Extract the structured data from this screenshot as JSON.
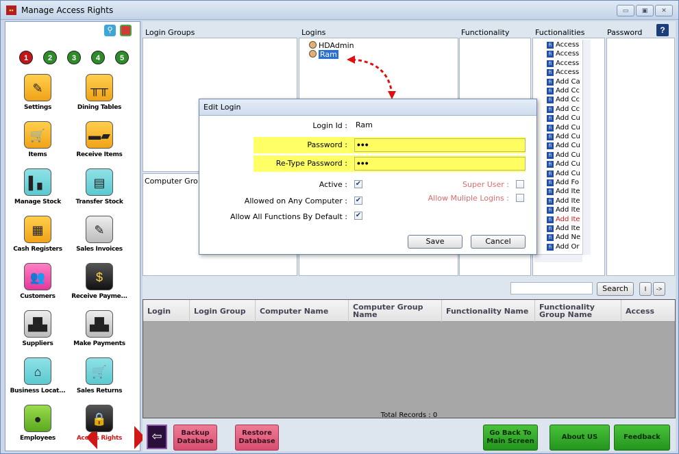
{
  "window": {
    "title": "Manage Access Rights",
    "app_icon": "app-icon",
    "controls": [
      "minimize-icon",
      "maximize-icon",
      "close-icon"
    ]
  },
  "left_panel": {
    "step_numbers": [
      "1",
      "2",
      "3",
      "4",
      "5"
    ],
    "nav_items": [
      {
        "label": "Settings",
        "icon": "settings-icon"
      },
      {
        "label": "Dining Tables",
        "icon": "dining-tables-icon"
      },
      {
        "label": "Items",
        "icon": "items-cart-icon"
      },
      {
        "label": "Receive Items",
        "icon": "truck-icon"
      },
      {
        "label": "Manage Stock",
        "icon": "manage-stock-icon"
      },
      {
        "label": "Transfer Stock",
        "icon": "transfer-stock-icon"
      },
      {
        "label": "Cash Registers",
        "icon": "cash-register-icon"
      },
      {
        "label": "Sales Invoices",
        "icon": "sales-invoice-icon"
      },
      {
        "label": "Customers",
        "icon": "customers-icon"
      },
      {
        "label": "Receive Payme...",
        "icon": "receive-payment-icon"
      },
      {
        "label": "Suppliers",
        "icon": "suppliers-icon"
      },
      {
        "label": "Make Payments",
        "icon": "make-payments-icon"
      },
      {
        "label": "Business Locat...",
        "icon": "business-location-icon"
      },
      {
        "label": "Sales Returns",
        "icon": "sales-returns-icon"
      },
      {
        "label": "Employees",
        "icon": "employees-icon"
      },
      {
        "label": "Access Rights",
        "icon": "access-rights-icon"
      }
    ]
  },
  "columns": {
    "login_groups": "Login Groups",
    "logins": "Logins",
    "functionality": "Functionality",
    "functionalities": "Fuctionalities",
    "password": "Password",
    "computer_groups": "Computer Gro"
  },
  "logins": [
    {
      "name": "HDAdmin",
      "selected": false
    },
    {
      "name": "Ram",
      "selected": true
    }
  ],
  "functionalities": [
    {
      "label": "Access",
      "highlight": false
    },
    {
      "label": "Access",
      "highlight": false
    },
    {
      "label": "Access",
      "highlight": false
    },
    {
      "label": "Access",
      "highlight": false
    },
    {
      "label": "Add Ca",
      "highlight": false
    },
    {
      "label": "Add Cc",
      "highlight": false
    },
    {
      "label": "Add Cc",
      "highlight": false
    },
    {
      "label": "Add Cc",
      "highlight": false
    },
    {
      "label": "Add Cu",
      "highlight": false
    },
    {
      "label": "Add Cu",
      "highlight": false
    },
    {
      "label": "Add Cu",
      "highlight": false
    },
    {
      "label": "Add Cu",
      "highlight": false
    },
    {
      "label": "Add Cu",
      "highlight": false
    },
    {
      "label": "Add Cu",
      "highlight": false
    },
    {
      "label": "Add Cu",
      "highlight": false
    },
    {
      "label": "Add Fo",
      "highlight": false
    },
    {
      "label": "Add Ite",
      "highlight": false
    },
    {
      "label": "Add Ite",
      "highlight": false
    },
    {
      "label": "Add Ite",
      "highlight": false
    },
    {
      "label": "Add Ite",
      "highlight": true
    },
    {
      "label": "Add Ite",
      "highlight": false
    },
    {
      "label": "Add Ne",
      "highlight": false
    },
    {
      "label": "Add Or",
      "highlight": false
    }
  ],
  "search": {
    "value": "",
    "button": "Search",
    "page_label": "I",
    "next_label": "->"
  },
  "grid": {
    "headers": [
      "Login",
      "Login Group",
      "Computer Name",
      "Computer Group Name",
      "Functionality Name",
      "Functionality Group Name",
      "Access"
    ]
  },
  "total_records": "Total Records : 0",
  "bottom_buttons": {
    "backup": "Backup Database",
    "restore": "Restore Database",
    "go_back": "Go Back To Main Screen",
    "about": "About US",
    "feedback": "Feedback"
  },
  "dialog": {
    "title": "Edit Login",
    "login_id_label": "Login Id :",
    "login_id_value": "Ram",
    "password_label": "Password :",
    "password_value": "•••",
    "retype_label": "Re-Type Password :",
    "retype_value": "•••",
    "active_label": "Active :",
    "active": true,
    "any_computer_label": "Allowed on Any Computer :",
    "any_computer": true,
    "all_functions_label": "Allow All Functions By Default :",
    "all_functions": true,
    "super_user_label": "Super User :",
    "super_user": false,
    "multiple_logins_label": "Allow Muliple Logins :",
    "multiple_logins": false,
    "save": "Save",
    "cancel": "Cancel"
  },
  "colors": {
    "highlight_yellow": "#ffff66",
    "annotation_red": "#e01010",
    "button_pink": "#d84e6e",
    "button_green": "#23941d"
  }
}
